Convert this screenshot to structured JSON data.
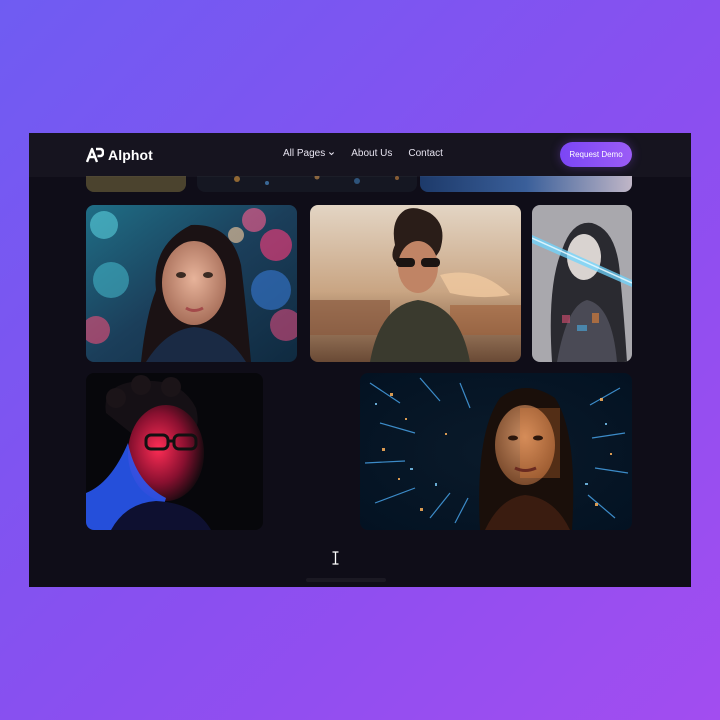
{
  "brand": {
    "name": "Alphot",
    "logo_icon": "ap-monogram-icon"
  },
  "nav": {
    "items": [
      {
        "label": "All Pages",
        "has_dropdown": true
      },
      {
        "label": "About Us",
        "has_dropdown": false
      },
      {
        "label": "Contact",
        "has_dropdown": false
      }
    ],
    "cta_label": "Request Demo"
  },
  "colors": {
    "page_bg_start": "#6f5cf2",
    "page_bg_end": "#a24df0",
    "window_bg": "#0f0d18",
    "navbar_bg": "#16141f",
    "accent": "#8b55f6"
  },
  "gallery": {
    "images": [
      {
        "subject": "woman with colorful bokeh background"
      },
      {
        "subject": "woman in sunglasses with surreal double exposure"
      },
      {
        "subject": "woman with blue light streak in grayscale"
      },
      {
        "subject": "man with glasses in red and blue neon light"
      },
      {
        "subject": "woman with digital data light tunnel"
      }
    ]
  }
}
